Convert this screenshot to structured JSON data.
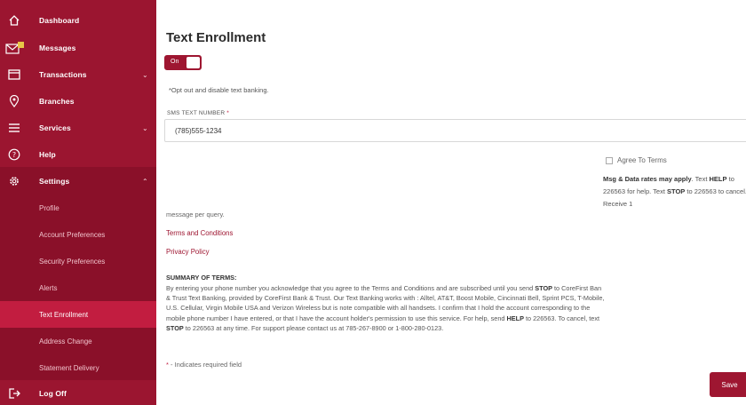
{
  "sidebar": {
    "items": [
      {
        "label": "Dashboard",
        "icon": "home-icon"
      },
      {
        "label": "Messages",
        "icon": "mail-icon",
        "badge": "1"
      },
      {
        "label": "Transactions",
        "icon": "card-icon"
      },
      {
        "label": "Branches",
        "icon": "location-pin-icon"
      },
      {
        "label": "Services",
        "icon": "menu-lines-icon"
      },
      {
        "label": "Help",
        "icon": "question-icon"
      },
      {
        "label": "Settings",
        "icon": "gear-icon"
      }
    ],
    "settings_sub": [
      {
        "label": "Profile"
      },
      {
        "label": "Account Preferences"
      },
      {
        "label": "Security Preferences"
      },
      {
        "label": "Alerts"
      },
      {
        "label": "Text Enrollment"
      },
      {
        "label": "Address Change"
      },
      {
        "label": "Statement Delivery"
      }
    ],
    "logoff": {
      "label": "Log Off",
      "icon": "logout-icon"
    }
  },
  "main": {
    "title": "Text Enrollment",
    "toggle_label": "On",
    "opt_out_text": "*Opt out and disable text banking.",
    "sms_label": "SMS TEXT NUMBER",
    "sms_required": "*",
    "sms_value": "(785)555-1234",
    "agree_label": "Agree To Terms",
    "msg_rates_bold": "Msg & Data rates may apply",
    "msg_rates_text1": ". Text",
    "help_word": "HELP",
    "msg_rates_text2": "to 226563 for help. Text",
    "stop_word": "STOP",
    "msg_rates_text3": "to 226563 to cancel. Receive 1",
    "msg_cont": "message per query.",
    "terms_link": "Terms and Conditions",
    "privacy_link": "Privacy Policy",
    "summary_heading": "SUMMARY OF TERMS:",
    "summary": {
      "l1a": "By entering your phone number you acknowledge that you agree to the Terms and Conditions and are subscribed until you send",
      "l1b": "STOP",
      "l1c": "to CoreFirst Ban",
      "l2": "& Trust Text Banking, provided by CoreFirst Bank & Trust. Our Text Banking works with : Alltel, AT&T, Boost Mobile, Cincinnati Bell, Sprint PCS, T-Mobile,",
      "l3": "U.S. Cellular, Virgin Mobile USA and Verizon Wireless but is note compatible with all handsets. I confirm that I hold the account corresponding to the",
      "l4a": "mobile phone number I have entered, or that I have the account holder's permission to use this service. For help, send",
      "l4b": "HELP",
      "l4c": "to 226563. To cancel, text",
      "l5a": "STOP",
      "l5b": "to 226563 at any time. For support please contact us at 785-267-8900 or 1-800-280-0123."
    },
    "required_star": "*",
    "required_note": "- Indicates required field",
    "save_label": "Save"
  },
  "colors": {
    "sidebar": "#9b1530",
    "accent": "#9e1631",
    "active_item": "#c21d40"
  }
}
